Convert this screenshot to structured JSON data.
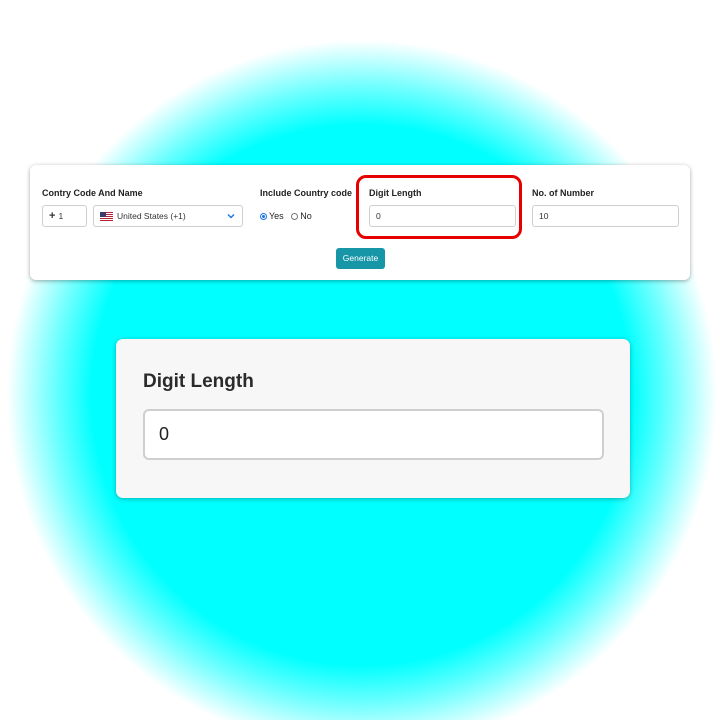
{
  "form": {
    "country_label": "Contry Code And Name",
    "country_code_value": "1",
    "country_code_prefix": "+",
    "country_select_value": "United States (+1)",
    "include_code_label": "Include Country code",
    "radio_yes_label": "Yes",
    "radio_no_label": "No",
    "radio_selected": "Yes",
    "digit_length_label": "Digit Length",
    "digit_length_value": "0",
    "num_count_label": "No. of Number",
    "num_count_value": "10",
    "generate_label": "Generate"
  },
  "zoom": {
    "label": "Digit Length",
    "value": "0"
  },
  "colors": {
    "glow": "#00ffff",
    "button": "#1796a8",
    "highlight": "#e60000",
    "radio_accent": "#1a73e8"
  },
  "icons": [
    "us-flag-icon",
    "chevron-down-icon",
    "radio-icon"
  ]
}
